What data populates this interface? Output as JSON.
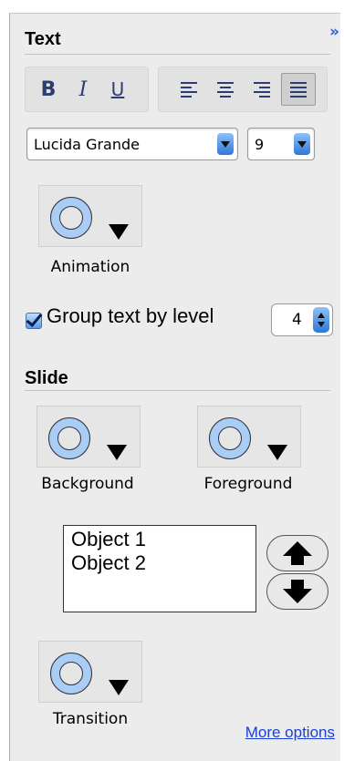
{
  "collapse_glyph": "»",
  "text_section": {
    "title": "Text",
    "format_buttons": {
      "bold": "B",
      "italic": "I",
      "underline": "U"
    },
    "align_buttons": [
      "align-left",
      "align-center",
      "align-right",
      "align-justify"
    ],
    "active_align": "align-justify",
    "font": {
      "family_value": "Lucida Grande",
      "size_value": "9"
    },
    "animation_label": "Animation",
    "group_checkbox": {
      "label": "Group text by level",
      "checked": true
    },
    "level_value": "4"
  },
  "slide_section": {
    "title": "Slide",
    "background_label": "Background",
    "foreground_label": "Foreground",
    "objects": [
      "Object 1",
      "Object 2"
    ],
    "transition_label": "Transition"
  },
  "more_options": "More options",
  "colors": {
    "panel": "#ececec",
    "well_ring": "#a9cdf6",
    "link": "#1a3fd6",
    "accent": "#2f77d9"
  }
}
